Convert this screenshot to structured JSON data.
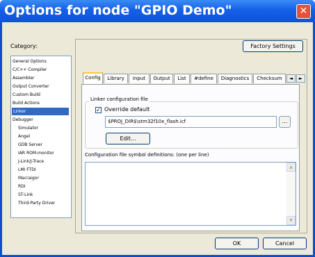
{
  "window": {
    "title": "Options for node \"GPIO Demo\"",
    "close_glyph": "✕"
  },
  "category": {
    "label": "Category:",
    "items": [
      {
        "label": "General Options",
        "indent": false,
        "selected": false
      },
      {
        "label": "C/C++ Compiler",
        "indent": false,
        "selected": false
      },
      {
        "label": "Assembler",
        "indent": false,
        "selected": false
      },
      {
        "label": "Output Converter",
        "indent": false,
        "selected": false
      },
      {
        "label": "Custom Build",
        "indent": false,
        "selected": false
      },
      {
        "label": "Build Actions",
        "indent": false,
        "selected": false
      },
      {
        "label": "Linker",
        "indent": false,
        "selected": true
      },
      {
        "label": "Debugger",
        "indent": false,
        "selected": false
      },
      {
        "label": "Simulator",
        "indent": true,
        "selected": false
      },
      {
        "label": "Angel",
        "indent": true,
        "selected": false
      },
      {
        "label": "GDB Server",
        "indent": true,
        "selected": false
      },
      {
        "label": "IAR ROM-monitor",
        "indent": true,
        "selected": false
      },
      {
        "label": "J-Link/J-Trace",
        "indent": true,
        "selected": false
      },
      {
        "label": "LMI FTDI",
        "indent": true,
        "selected": false
      },
      {
        "label": "Macraigor",
        "indent": true,
        "selected": false
      },
      {
        "label": "RDI",
        "indent": true,
        "selected": false
      },
      {
        "label": "ST-Link",
        "indent": true,
        "selected": false
      },
      {
        "label": "Third-Party Driver",
        "indent": true,
        "selected": false
      }
    ]
  },
  "factory_settings_label": "Factory Settings",
  "tabs": [
    {
      "label": "Config",
      "active": true
    },
    {
      "label": "Library",
      "active": false
    },
    {
      "label": "Input",
      "active": false
    },
    {
      "label": "Output",
      "active": false
    },
    {
      "label": "List",
      "active": false
    },
    {
      "label": "#define",
      "active": false
    },
    {
      "label": "Diagnostics",
      "active": false
    },
    {
      "label": "Checksum",
      "active": false
    }
  ],
  "tab_scroll": {
    "left": "◄",
    "right": "►"
  },
  "linker_config": {
    "group_title": "Linker configuration file",
    "override_label": "Override default",
    "override_checked": true,
    "check_glyph": "✓",
    "path_value": "$PROJ_DIR$\\stm32f10x_flash.icf",
    "browse_label": "...",
    "edit_label": "Edit..."
  },
  "symbol_defs": {
    "label": "Configuration file symbol definitions: (one per line)",
    "value": ""
  },
  "scroll": {
    "up": "▲",
    "down": "▼"
  },
  "ok_label": "OK",
  "cancel_label": "Cancel"
}
